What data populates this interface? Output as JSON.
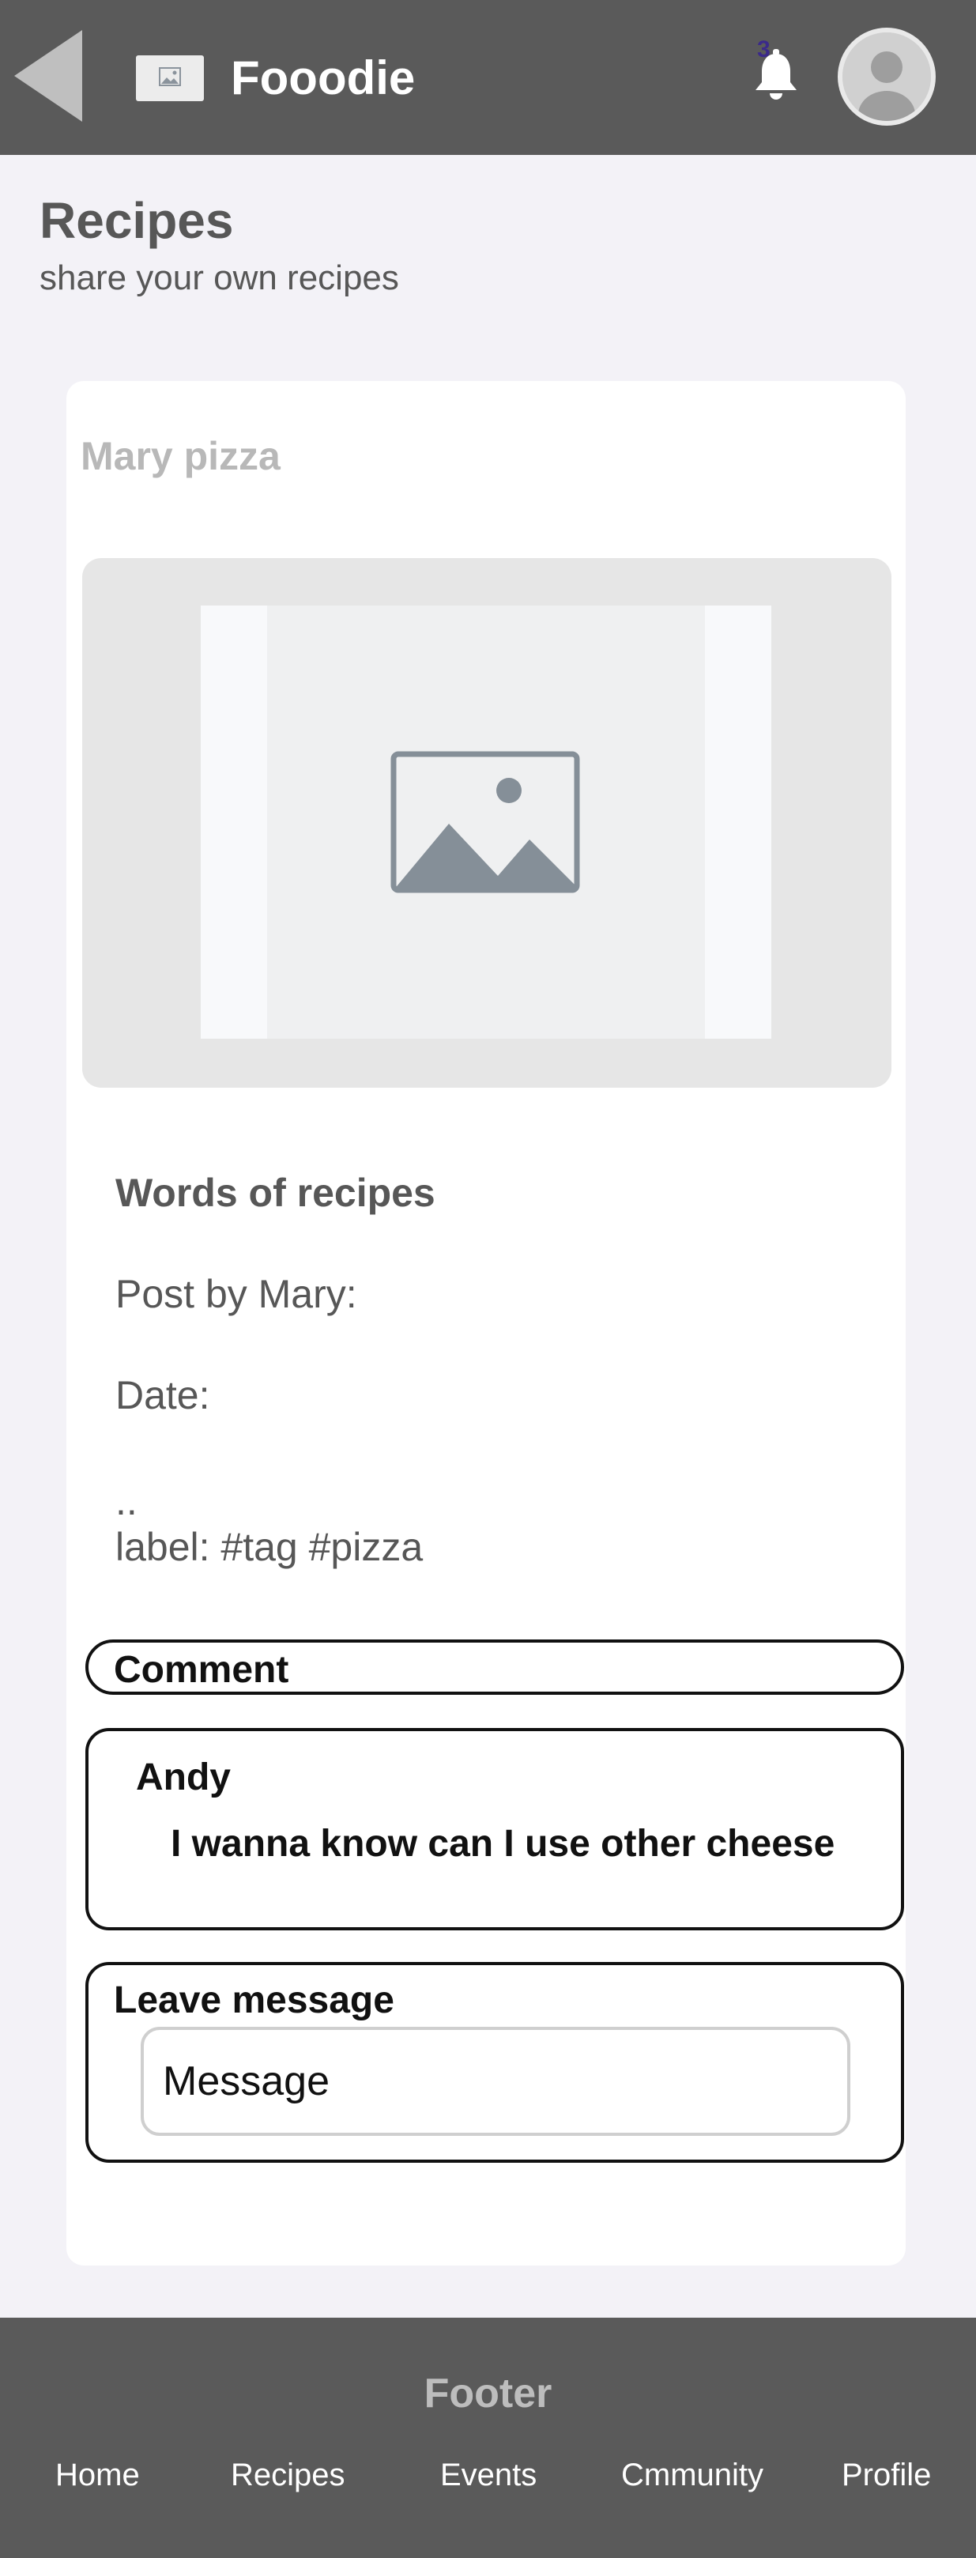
{
  "header": {
    "app_name": "Fooodie",
    "notification_count": "3",
    "icons": {
      "back": "back-arrow-icon",
      "logo": "image-placeholder-icon",
      "bell": "bell-icon",
      "avatar": "user-avatar-icon"
    }
  },
  "page": {
    "title": "Recipes",
    "subtitle": "share your own recipes"
  },
  "recipe": {
    "title": "Mary pizza",
    "image_icon": "image-placeholder-icon",
    "words_title": "Words of recipes",
    "posted_by": "Post by Mary:",
    "date": "Date:",
    "ellipsis": "..",
    "label": "label: #tag #pizza"
  },
  "comments": {
    "section_label": "Comment",
    "items": [
      {
        "author": "Andy",
        "text": "I wanna know can I use other cheese"
      }
    ]
  },
  "leave_message": {
    "label": "Leave message",
    "placeholder": "Message"
  },
  "footer": {
    "title": "Footer",
    "links": [
      "Home",
      "Recipes",
      "Events",
      "Cmmunity",
      "Profile"
    ]
  },
  "colors": {
    "header_bg": "#5a5a5a",
    "page_bg": "#f3f2f7",
    "badge": "#3b2a8a"
  }
}
